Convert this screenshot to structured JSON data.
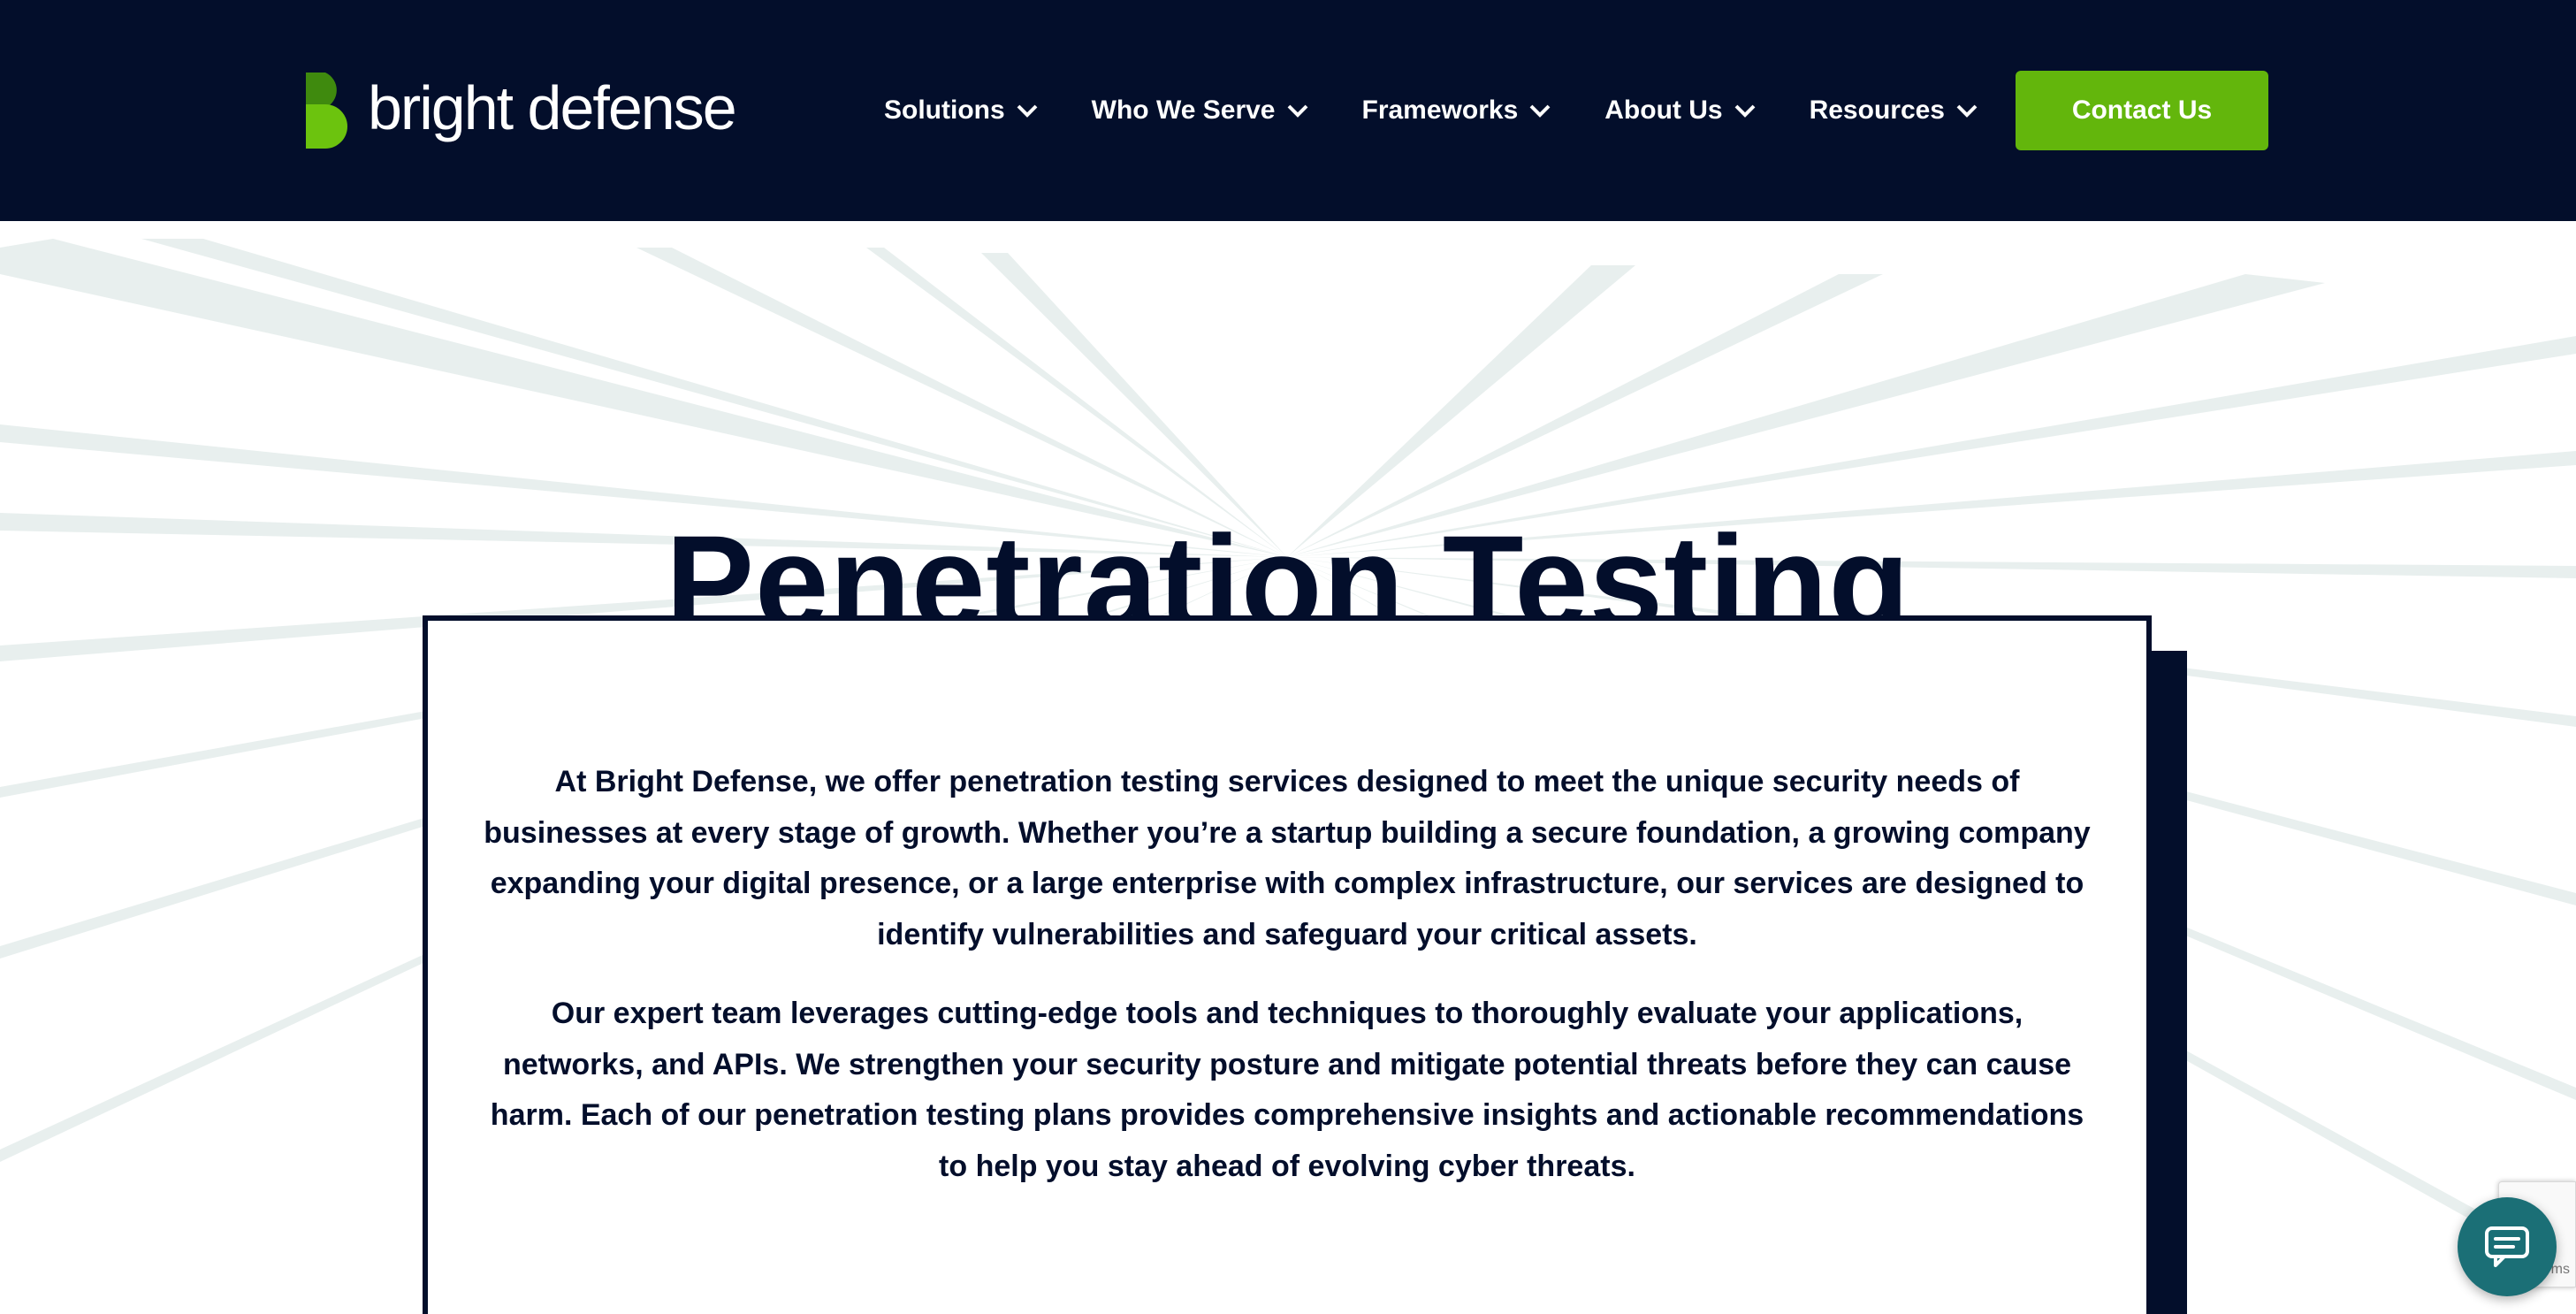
{
  "header": {
    "logo_text": "bright defense",
    "nav": [
      {
        "label": "Solutions"
      },
      {
        "label": "Who We Serve"
      },
      {
        "label": "Frameworks"
      },
      {
        "label": "About Us"
      },
      {
        "label": "Resources"
      }
    ],
    "cta_label": "Contact Us"
  },
  "hero": {
    "title": "Penetration Testing",
    "paragraphs": [
      "At Bright Defense, we offer penetration testing services designed to meet the unique security needs of businesses at every stage of growth. Whether you’re a startup building a secure foundation, a growing company expanding your digital presence, or a large enterprise with complex infrastructure, our services are designed to identify vulnerabilities and safeguard your critical assets.",
      "Our expert team leverages cutting-edge tools and techniques to thoroughly evaluate your applications, networks, and APIs. We strengthen your security posture and mitigate potential threats before they can cause harm. Each of our penetration testing plans provides comprehensive insights and actionable recommendations to help you stay ahead of evolving cyber threats."
    ]
  },
  "widgets": {
    "recaptcha_text": "ms",
    "chat_icon": "chat-bubble-icon"
  },
  "colors": {
    "navy": "#030e2b",
    "brand_green": "#63b60c",
    "chat_teal": "#1b6f76"
  }
}
